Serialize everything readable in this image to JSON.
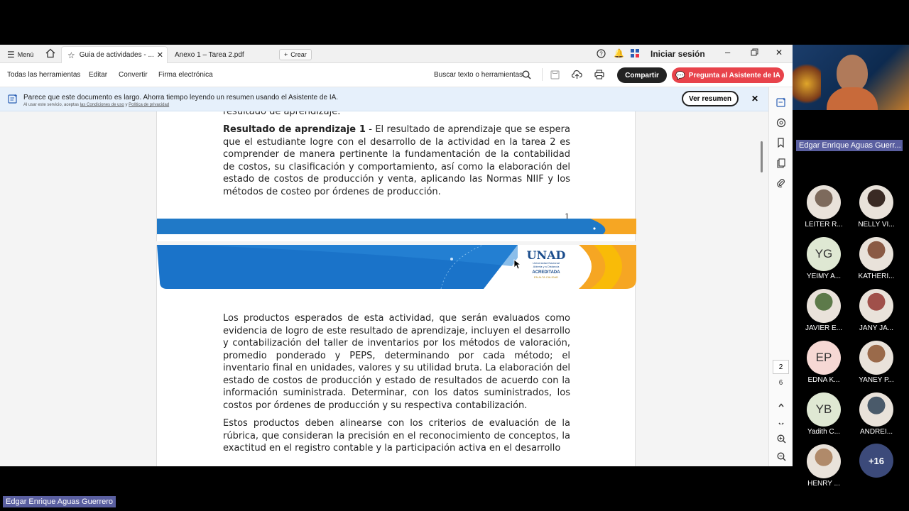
{
  "browser": {
    "menu_label": "Menú",
    "tabs": [
      {
        "label": "Guia de actividades - ..."
      },
      {
        "label": "Anexo 1 – Tarea 2.pdf"
      }
    ],
    "new_tab_label": "Crear",
    "signin_label": "Iniciar sesión"
  },
  "toolbar": {
    "all_tools": "Todas las herramientas",
    "edit": "Editar",
    "convert": "Convertir",
    "esign": "Firma electrónica",
    "search_label": "Buscar texto o herramientas",
    "share_label": "Compartir",
    "ai_label": "Pregunta al Asistente de IA"
  },
  "banner": {
    "message": "Parece que este documento es largo. Ahorra tiempo leyendo un resumen usando el Asistente de IA.",
    "fine_print_prefix": "Al usar este servicio, aceptas",
    "terms_link": "las Condiciones de uso",
    "fine_print_and": "y",
    "privacy_link": "Política de privacidad",
    "summary_button": "Ver resumen"
  },
  "document": {
    "top_cut_text": "resultado de aprendizaje.",
    "result_heading": "Resultado de aprendizaje 1",
    "result_text": " - El resultado de aprendizaje que se espera que el estudiante logre con el desarrollo de la actividad en la tarea 2 es comprender de manera pertinente la fundamentación de la contabilidad de costos, su clasificación y comportamiento, así como la elaboración del estado de costos de producción y venta, aplicando las Normas NIIF y los métodos de costeo por órdenes de producción.",
    "page_number": "1",
    "logo_text": "UNAD",
    "logo_sub1": "Universidad Nacional",
    "logo_sub2": "Abierta y a Distancia",
    "logo_acc": "ACREDITADA",
    "logo_acc_sub": "EN ALTA CALIDAD",
    "para2": "Los productos esperados de esta actividad, que serán evaluados como evidencia de logro de este resultado de aprendizaje, incluyen el desarrollo y contabilización del taller de inventarios por los métodos de valoración, promedio ponderado y PEPS, determinando por cada método; el inventario final en unidades, valores y su utilidad bruta. La elaboración del estado de costos de producción y estado de resultados de acuerdo con la información suministrada. Determinar, con los datos suministrados, los costos por órdenes de producción y su respectiva contabilización.",
    "para3": "Estos productos deben alinearse con los criterios de evaluación de la rúbrica, que consideran la precisión en el reconocimiento de conceptos, la exactitud en el registro contable y la participación activa en el desarrollo"
  },
  "page_nav": {
    "current_page": "2",
    "total_pages": "6"
  },
  "meeting": {
    "presenter_tag": "Edgar Enrique Aguas Guerr...",
    "bottom_name_tag": "Edgar Enrique Aguas Guerrero",
    "participants": [
      {
        "name": "LEITER R...",
        "initials": ""
      },
      {
        "name": "NELLY VI...",
        "initials": ""
      },
      {
        "name": "YEIMY A...",
        "initials": "YG"
      },
      {
        "name": "KATHERI...",
        "initials": ""
      },
      {
        "name": "JAVIER E...",
        "initials": ""
      },
      {
        "name": "JANY JA...",
        "initials": ""
      },
      {
        "name": "EDNA K...",
        "initials": "EP"
      },
      {
        "name": "YANEY P...",
        "initials": ""
      },
      {
        "name": "Yadith C...",
        "initials": "YB"
      },
      {
        "name": "ANDREI...",
        "initials": ""
      },
      {
        "name": "HENRY ...",
        "initials": ""
      }
    ],
    "more_count": "+16"
  }
}
